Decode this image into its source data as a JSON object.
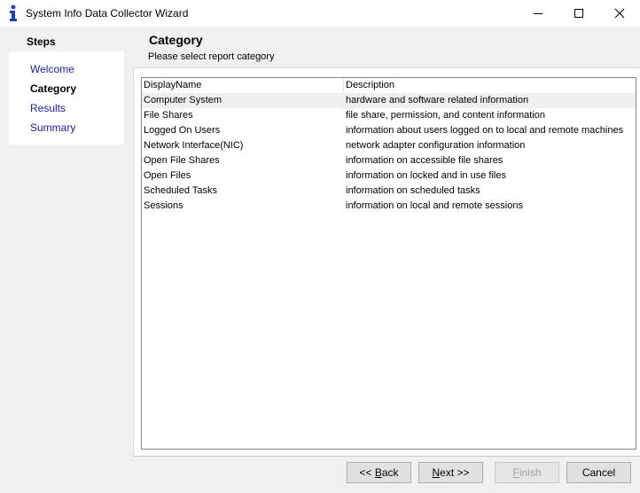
{
  "window": {
    "title": "System Info Data Collector Wizard",
    "icon": "info-icon",
    "controls": [
      "minimize-icon",
      "maximize-icon",
      "close-icon"
    ]
  },
  "steps": {
    "title": "Steps",
    "items": [
      {
        "label": "Welcome",
        "state": "link"
      },
      {
        "label": "Category",
        "state": "current"
      },
      {
        "label": "Results",
        "state": "link"
      },
      {
        "label": "Summary",
        "state": "link"
      }
    ]
  },
  "header": {
    "title": "Category",
    "subtitle": "Please select report category"
  },
  "table": {
    "columns": [
      "DisplayName",
      "Description"
    ],
    "selected_index": 0,
    "rows": [
      [
        "Computer System",
        "hardware and software related information"
      ],
      [
        "File Shares",
        "file share, permission, and content information"
      ],
      [
        "Logged On Users",
        "information about users logged on to local and remote machines"
      ],
      [
        "Network Interface(NIC)",
        "network adapter configuration information"
      ],
      [
        "Open File Shares",
        "information on accessible file shares"
      ],
      [
        "Open Files",
        "information on locked and in use files"
      ],
      [
        "Scheduled Tasks",
        "information on scheduled tasks"
      ],
      [
        "Sessions",
        "information on local and remote sessions"
      ]
    ]
  },
  "buttons": {
    "back": {
      "prefix": "<< ",
      "mnemonic": "B",
      "rest": "ack"
    },
    "next": {
      "mnemonic": "N",
      "rest": "ext >>"
    },
    "finish": {
      "mnemonic": "F",
      "rest": "inish"
    },
    "cancel": "Cancel"
  },
  "colors": {
    "link": "#1a1aa6",
    "icon_blue": "#1e3cc8"
  }
}
